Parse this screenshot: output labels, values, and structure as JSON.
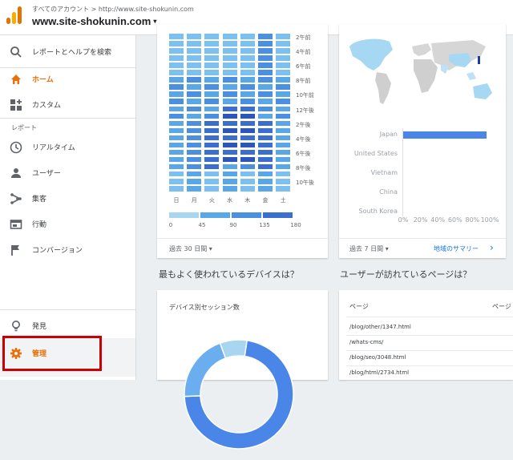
{
  "header": {
    "breadcrumb_account": "すべてのアカウント",
    "breadcrumb_sep": ">",
    "breadcrumb_property": "http://www.site-shokunin.com",
    "account_name": "www.site-shokunin.com",
    "dropdown": "▾"
  },
  "sidebar": {
    "search_label": "レポートとヘルプを検索",
    "home": "ホーム",
    "custom": "カスタム",
    "section_reports": "レポート",
    "realtime": "リアルタイム",
    "users": "ユーザー",
    "acquisition": "集客",
    "behavior": "行動",
    "conversions": "コンバージョン",
    "discover": "発見",
    "admin": "管理"
  },
  "heatmap": {
    "row_labels": [
      "2午前",
      "4午前",
      "6午前",
      "8午前",
      "10午前",
      "12午後",
      "2午後",
      "4午後",
      "6午後",
      "8午後",
      "10午後"
    ],
    "days": [
      "日",
      "月",
      "火",
      "水",
      "木",
      "金",
      "土"
    ],
    "legend_values": [
      "0",
      "45",
      "90",
      "135",
      "180"
    ],
    "legend_colors": [
      "#a8d5f0",
      "#5aa7e8",
      "#4a8fe0",
      "#3a6fd0"
    ],
    "date_range": "過去 30 日間 ▾"
  },
  "geo": {
    "countries": [
      "Japan",
      "United States",
      "Vietnam",
      "China",
      "South Korea"
    ],
    "share": [
      0.96,
      0,
      0,
      0,
      0
    ],
    "axis": [
      "0%",
      "20%",
      "40%",
      "60%",
      "80%",
      "100%"
    ],
    "date_range": "過去 7 日間 ▾",
    "link": "地域のサマリー",
    "chevron": "›",
    "bar_color": "#4a86e8"
  },
  "sections": {
    "devices_q": "最もよく使われているデバイスは？",
    "pages_q": "ユーザーが訪れているページは？"
  },
  "devices": {
    "title": "デバイス別セッション数",
    "slices": [
      {
        "value": 0.72,
        "color": "#4a86e8"
      },
      {
        "value": 0.2,
        "color": "#6aaef0"
      },
      {
        "value": 0.08,
        "color": "#a8d5f0"
      }
    ]
  },
  "pages": {
    "col_header": "ページ",
    "col_header2": "ページ",
    "items": [
      "/blog/other/1347.html",
      "/whats-cms/",
      "/blog/seo/3048.html",
      "/blog/html/2734.html"
    ]
  }
}
